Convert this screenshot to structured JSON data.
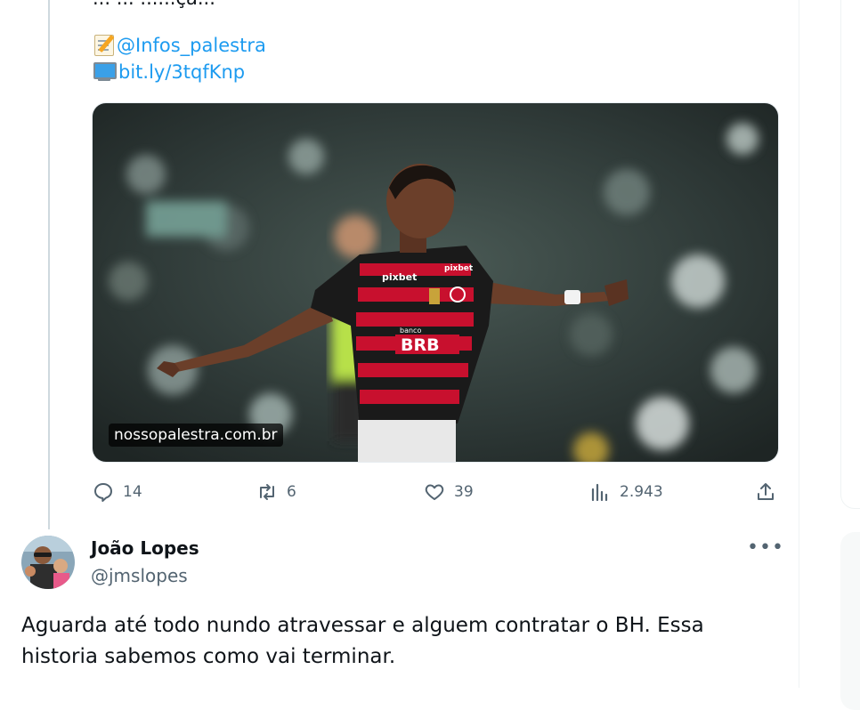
{
  "tweet": {
    "partial_text": "... ... ......çã...",
    "links": [
      {
        "icon": "memo-icon",
        "text": "@Infos_palestra"
      },
      {
        "icon": "computer-icon",
        "text": "bit.ly/3tqfKnp"
      }
    ],
    "media": {
      "caption": "nossopalestra.com.br",
      "jersey_sponsor": "pixbet",
      "jersey_sponsor_2": "BRB",
      "jersey_banco": "banco"
    },
    "actions": {
      "replies": "14",
      "retweets": "6",
      "likes": "39",
      "views": "2.943"
    }
  },
  "reply": {
    "name": "João Lopes",
    "handle": "@jmslopes",
    "text": "Aguarda até todo nundo atravessar e alguem contratar o BH. Essa historia sabemos como vai terminar."
  },
  "colors": {
    "link": "#1d9bf0",
    "secondary": "#536471",
    "jersey_red": "#c8102e",
    "jersey_black": "#1a1a1a"
  }
}
